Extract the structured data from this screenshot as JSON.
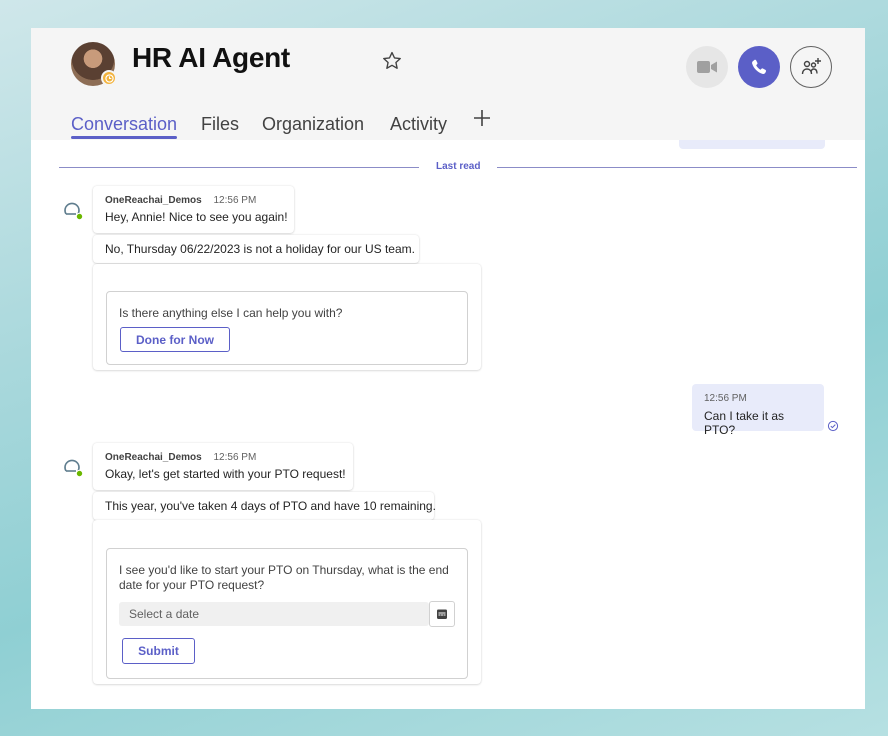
{
  "header": {
    "title": "HR AI Agent",
    "tabs": [
      "Conversation",
      "Files",
      "Organization",
      "Activity"
    ],
    "icons": {
      "favorite": "star-icon",
      "video": "video-camera-icon",
      "call": "phone-icon",
      "participants": "add-people-icon",
      "add_tab": "plus-icon",
      "presence": "clock-icon"
    }
  },
  "divider": {
    "label": "Last read"
  },
  "messages": [
    {
      "sender": "OneReachai_Demos",
      "time": "12:56 PM",
      "text": "Hey, Annie! Nice to see you again!",
      "followup": "No, Thursday 06/22/2023 is not a holiday for our US team.",
      "card": {
        "prompt": "Is there anything else I can help you with?",
        "button": "Done for Now"
      }
    },
    {
      "time": "12:56 PM",
      "text": "Can I take it as PTO?"
    },
    {
      "sender": "OneReachai_Demos",
      "time": "12:56 PM",
      "text": "Okay, let's get started with your PTO request!",
      "followup": "This year, you've taken 4 days of PTO and have 10 remaining.",
      "card": {
        "prompt_line1": "I see you'd like to start your PTO on Thursday, what is the end",
        "prompt_line2": "date for your PTO request?",
        "date_placeholder": "Select a date",
        "button": "Submit"
      }
    }
  ],
  "colors": {
    "accent": "#5b5fc7",
    "my_bubble": "#e8ebfa",
    "online": "#6bb700",
    "away": "#f3b33d"
  }
}
